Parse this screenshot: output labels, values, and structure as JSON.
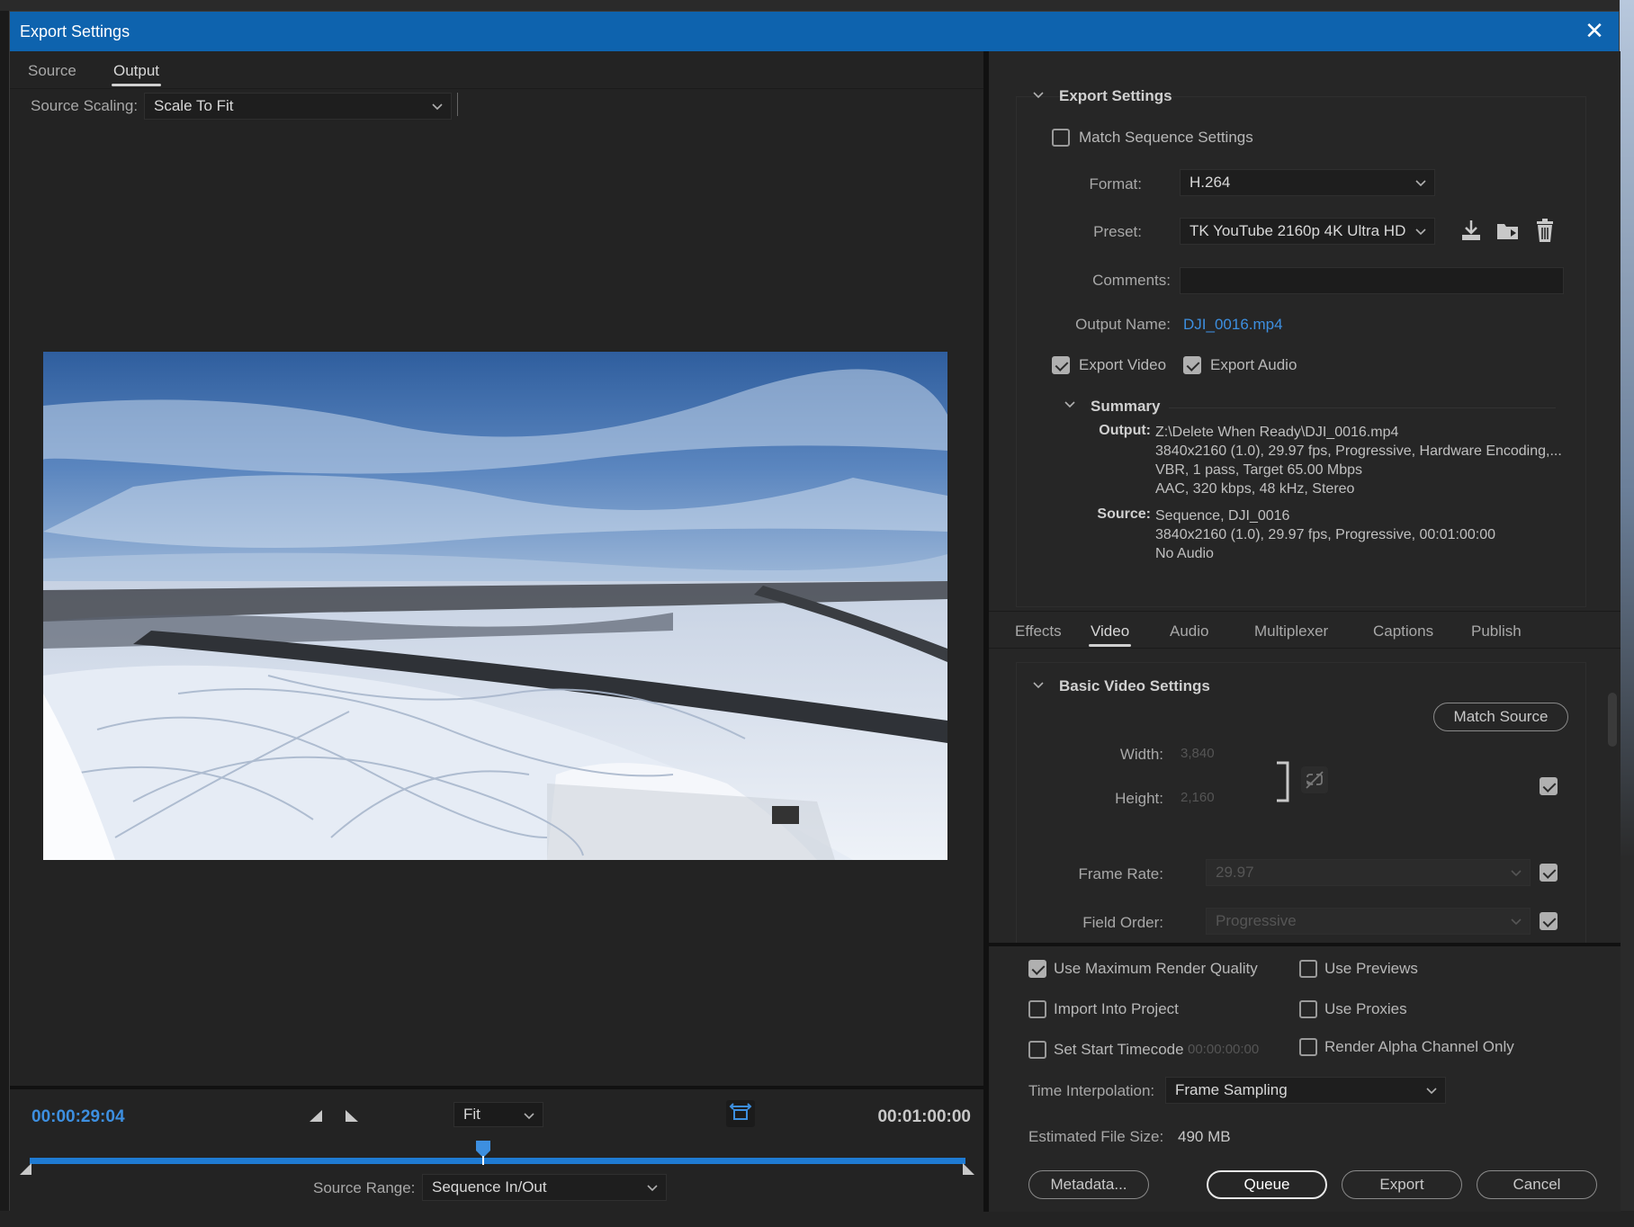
{
  "window": {
    "title": "Export Settings"
  },
  "left": {
    "tabs": [
      {
        "label": "Source"
      },
      {
        "label": "Output"
      }
    ],
    "source_scaling": {
      "label": "Source Scaling:",
      "value": "Scale To Fit"
    },
    "current_time": "00:00:29:04",
    "end_time": "00:01:00:00",
    "zoom": "Fit",
    "source_range": {
      "label": "Source Range:",
      "value": "Sequence In/Out"
    },
    "playhead_fraction": 0.485
  },
  "export": {
    "section_title": "Export Settings",
    "match_sequence": "Match Sequence Settings",
    "format": {
      "label": "Format:",
      "value": "H.264"
    },
    "preset": {
      "label": "Preset:",
      "value": "TK YouTube 2160p 4K Ultra HD"
    },
    "comments": {
      "label": "Comments:",
      "value": ""
    },
    "output_name": {
      "label": "Output Name:",
      "value": "DJI_0016.mp4"
    },
    "export_video": "Export Video",
    "export_audio": "Export Audio"
  },
  "summary": {
    "title": "Summary",
    "output_key": "Output:",
    "output_lines": [
      "Z:\\Delete When Ready\\DJI_0016.mp4",
      "3840x2160 (1.0), 29.97 fps, Progressive, Hardware Encoding,...",
      "VBR, 1 pass, Target 65.00 Mbps",
      "AAC, 320 kbps, 48 kHz, Stereo"
    ],
    "source_key": "Source:",
    "source_lines": [
      "Sequence, DJI_0016",
      "3840x2160 (1.0), 29.97 fps, Progressive, 00:01:00:00",
      "No Audio"
    ]
  },
  "settings_tabs": [
    {
      "label": "Effects"
    },
    {
      "label": "Video"
    },
    {
      "label": "Audio"
    },
    {
      "label": "Multiplexer"
    },
    {
      "label": "Captions"
    },
    {
      "label": "Publish"
    }
  ],
  "video": {
    "section_title": "Basic Video Settings",
    "match_source": "Match Source",
    "width_label": "Width:",
    "width": "3,840",
    "height_label": "Height:",
    "height": "2,160",
    "frame_rate_label": "Frame Rate:",
    "frame_rate": "29.97",
    "field_order_label": "Field Order:",
    "field_order": "Progressive"
  },
  "options": {
    "max_render_quality": "Use Maximum Render Quality",
    "use_previews": "Use Previews",
    "import_into_project": "Import Into Project",
    "use_proxies": "Use Proxies",
    "set_start_timecode": "Set Start Timecode",
    "start_timecode_value": "00:00:00:00",
    "render_alpha": "Render Alpha Channel Only",
    "time_interp_label": "Time Interpolation:",
    "time_interp_value": "Frame Sampling",
    "file_size_label": "Estimated File Size:",
    "file_size_value": "490 MB"
  },
  "buttons": {
    "metadata": "Metadata...",
    "queue": "Queue",
    "export": "Export",
    "cancel": "Cancel"
  },
  "colors": {
    "titlebar": "#0e63ae",
    "accent": "#3d8fe0",
    "timeline": "#1f7bd3"
  }
}
